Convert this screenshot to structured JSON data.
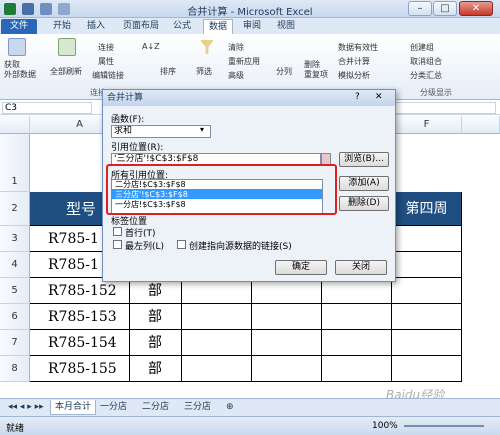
{
  "titlebar": {
    "title": "合并计算 - Microsoft Excel"
  },
  "window": {
    "minimize": "–",
    "maximize": "□",
    "close": "✕"
  },
  "tabs": [
    "文件",
    "开始",
    "插入",
    "页面布局",
    "公式",
    "数据",
    "审阅",
    "视图"
  ],
  "ribbon": {
    "get_external_data": "获取\n外部数据",
    "refresh_all": "全部刷新",
    "connections": "连接",
    "properties": "属性",
    "edit_links": "编辑链接",
    "connections_group": "连接",
    "sort_asc": "A↓Z",
    "sort": "排序",
    "filter": "筛选",
    "clear": "清除",
    "reapply": "重新应用",
    "advanced": "高级",
    "text_to_columns": "分列",
    "remove_duplicates": "删除\n重复项",
    "data_validation": "数据有效性",
    "consolidate": "合并计算",
    "what_if": "模拟分析",
    "group": "创建组",
    "ungroup": "取消组合",
    "subtotal": "分类汇总",
    "outline_group": "分级显示"
  },
  "formula_bar": {
    "name_box": "C3"
  },
  "grid": {
    "columns": [
      "A",
      "F"
    ],
    "rows": [
      "1",
      "2",
      "3",
      "4",
      "5",
      "6",
      "7",
      "8"
    ],
    "header_row": {
      "a": "型号",
      "f": "第四周"
    },
    "data": [
      {
        "a": "R785-1",
        "b": ""
      },
      {
        "a": "R785-1",
        "b": ""
      },
      {
        "a": "R785-152",
        "b": "部"
      },
      {
        "a": "R785-153",
        "b": "部"
      },
      {
        "a": "R785-154",
        "b": "部"
      },
      {
        "a": "R785-155",
        "b": "部"
      }
    ]
  },
  "sheets": [
    "本月合计",
    "一分店",
    "二分店",
    "三分店"
  ],
  "status": {
    "ready": "就绪",
    "zoom": "100%"
  },
  "dialog": {
    "title": "合并计算",
    "function_label": "函数(F):",
    "function_value": "求和",
    "ref_label": "引用位置(R):",
    "ref_value": "'三分店'!$C$3:$F$8",
    "browse": "浏览(B)...",
    "all_refs_label": "所有引用位置:",
    "all_refs": [
      "二分店!$C$3:$F$8",
      "三分店'!$C$3:$F$8",
      "一分店!$C$3:$F$8"
    ],
    "add": "添加(A)",
    "delete": "删除(D)",
    "label_pos": "标签位置",
    "top_row": "首行(T)",
    "left_col": "最左列(L)",
    "link_source": "创建指向源数据的链接(S)",
    "ok": "确定",
    "close": "关闭"
  },
  "watermark": "Baidu经验",
  "colors": {
    "header_fill": "#1f4f82",
    "file_tab": "#2a67b8",
    "highlight": "#e02020",
    "selection": "#3399ff"
  }
}
